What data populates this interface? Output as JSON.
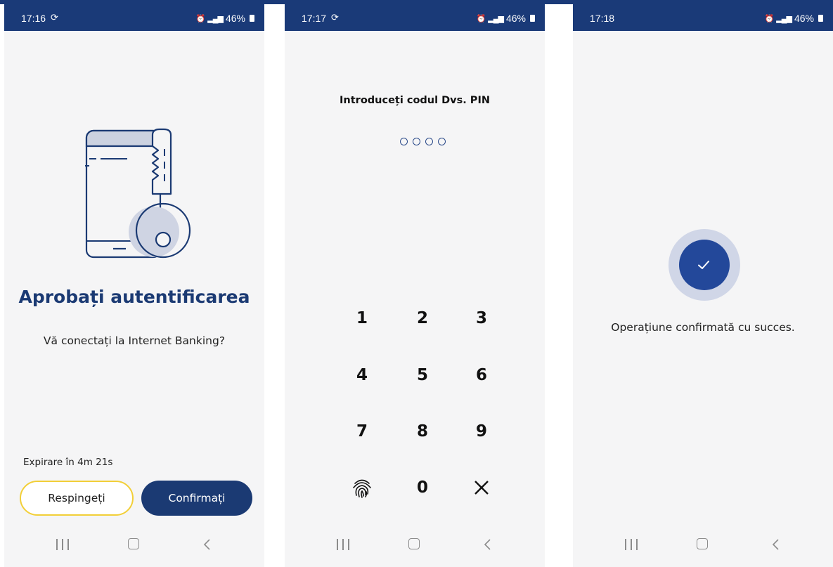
{
  "screens": [
    {
      "status": {
        "time": "17:16",
        "battery": "46%"
      },
      "title": "Aprobați autentificarea",
      "subtitle": "Vă conectați la Internet Banking?",
      "expiry": "Expirare în 4m 21s",
      "buttons": {
        "reject": "Respingeți",
        "confirm": "Confirmați"
      }
    },
    {
      "status": {
        "time": "17:17",
        "battery": "46%"
      },
      "pin_prompt": "Introduceți codul Dvs. PIN",
      "pin_length": 4,
      "keypad": [
        "1",
        "2",
        "3",
        "4",
        "5",
        "6",
        "7",
        "8",
        "9",
        "fingerprint-icon",
        "0",
        "delete-icon"
      ]
    },
    {
      "status": {
        "time": "17:18",
        "battery": "46%"
      },
      "message": "Operațiune confirmată cu succes."
    }
  ],
  "colors": {
    "primary": "#1b3a73",
    "status_bar": "#1a3a78",
    "accent_yellow": "#f2cf38",
    "background": "#f5f5f6",
    "success_ring": "#d0d6e7",
    "success_circle": "#23489a"
  },
  "icons": {
    "navbar": [
      "recent-apps-icon",
      "home-icon",
      "back-icon"
    ],
    "status": [
      "sync-icon",
      "alarm-icon",
      "volte-icon",
      "4g-icon",
      "signal-icon",
      "battery-icon"
    ]
  }
}
